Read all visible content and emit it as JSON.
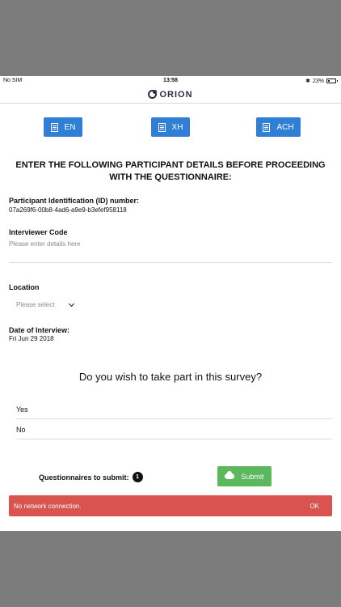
{
  "status_bar": {
    "carrier": "No SIM",
    "time": "13:58",
    "battery": "23%",
    "battery_level": 0.23
  },
  "app": {
    "logo_text": "ORION"
  },
  "languages": [
    {
      "label": "EN"
    },
    {
      "label": "XH"
    },
    {
      "label": "ACH"
    }
  ],
  "form": {
    "heading": "ENTER THE FOLLOWING PARTICIPANT DETAILS BEFORE PROCEEDING WITH THE QUESTIONNAIRE:",
    "participant_id_label": "Participant Identification (ID) number:",
    "participant_id_value": "07a269f6-00b8-4ad6-a9e9-b3efef958118",
    "interviewer_label": "Interviewer Code",
    "interviewer_placeholder": "Please enter details here",
    "location_label": "Location",
    "location_placeholder": "Please select",
    "date_label": "Date of Interview:",
    "date_value": "Fri Jun 29 2018"
  },
  "survey": {
    "question": "Do you wish to take part in this survey?",
    "options": [
      "Yes",
      "No"
    ]
  },
  "footer": {
    "questionnaires_label": "Questionnaires to submit:",
    "count": "1",
    "submit_label": "Submit"
  },
  "alert": {
    "message": "No network connection.",
    "ok_label": "OK"
  },
  "colors": {
    "primary": "#2f7fd6",
    "success": "#5cb85c",
    "danger": "#d9534f"
  }
}
